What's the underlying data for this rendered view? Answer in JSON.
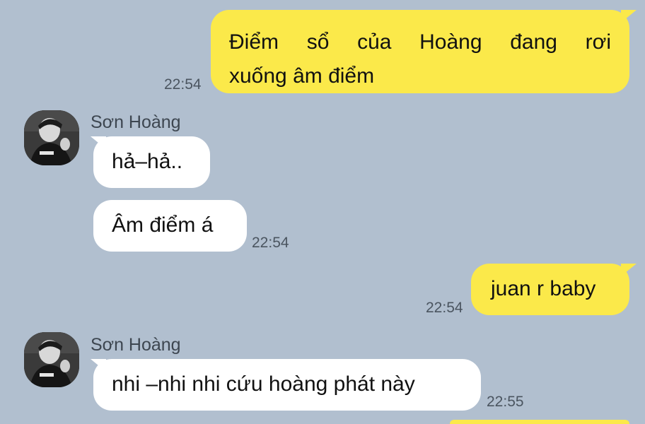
{
  "messages": [
    {
      "direction": "outgoing",
      "lines": [
        "Điểm sổ của Hoàng đang rơi",
        "xuống âm điểm"
      ],
      "time": "22:54"
    },
    {
      "direction": "incoming",
      "sender": "Sơn Hoàng",
      "text": "hả–hả..",
      "time": ""
    },
    {
      "direction": "incoming",
      "sender": "",
      "text": "Âm điểm á",
      "time": "22:54"
    },
    {
      "direction": "outgoing",
      "text": "juan r baby",
      "time": "22:54"
    },
    {
      "direction": "incoming",
      "sender": "Sơn Hoàng",
      "text": "nhi –nhi nhi cứu hoàng phát này",
      "time": "22:55"
    }
  ],
  "icons": {
    "avatar": "profile-photo"
  },
  "colors": {
    "background": "#b1bfcf",
    "outgoing_bubble": "#fbe94a",
    "incoming_bubble": "#ffffff",
    "time_text": "#4b5560",
    "sender_text": "#3d4650"
  }
}
